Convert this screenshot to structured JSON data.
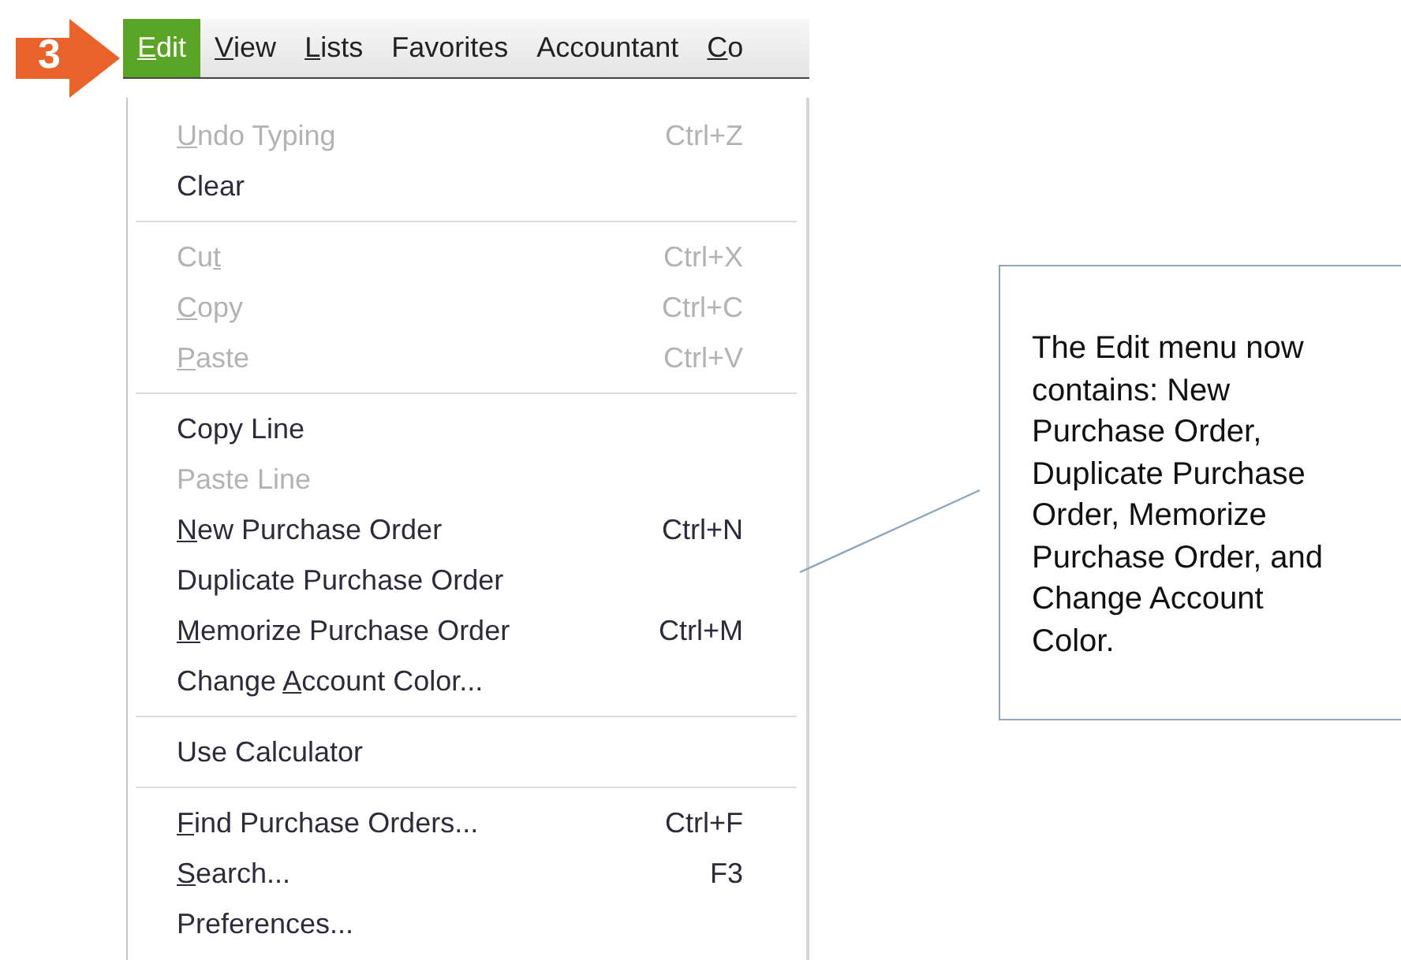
{
  "step_badge": {
    "number": "3"
  },
  "menu_bar": [
    {
      "key": "E",
      "post": "dit",
      "selected": true
    },
    {
      "key": "V",
      "post": "iew",
      "selected": false
    },
    {
      "key": "L",
      "post": "ists",
      "selected": false
    },
    {
      "pre": "Favorites",
      "selected": false
    },
    {
      "pre": "Accountant",
      "selected": false
    },
    {
      "key": "C",
      "post": "o",
      "selected": false
    }
  ],
  "menu": [
    {
      "kind": "item",
      "key": "U",
      "post": "ndo Typing",
      "shortcut": "Ctrl+Z",
      "disabled": true
    },
    {
      "kind": "item",
      "pre": "Clear",
      "disabled": false
    },
    {
      "kind": "separator"
    },
    {
      "kind": "item",
      "pre": "Cu",
      "key": "t",
      "shortcut": "Ctrl+X",
      "disabled": true
    },
    {
      "kind": "item",
      "key": "C",
      "post": "opy",
      "shortcut": "Ctrl+C",
      "disabled": true
    },
    {
      "kind": "item",
      "key": "P",
      "post": "aste",
      "shortcut": "Ctrl+V",
      "disabled": true
    },
    {
      "kind": "separator"
    },
    {
      "kind": "item",
      "pre": "Copy Line",
      "disabled": false
    },
    {
      "kind": "item",
      "pre": "Paste Line",
      "disabled": true
    },
    {
      "kind": "item",
      "key": "N",
      "post": "ew Purchase Order",
      "shortcut": "Ctrl+N",
      "disabled": false
    },
    {
      "kind": "item",
      "pre": "Duplicate Purchase Order",
      "disabled": false
    },
    {
      "kind": "item",
      "key": "M",
      "post": "emorize Purchase Order",
      "shortcut": "Ctrl+M",
      "disabled": false
    },
    {
      "kind": "item",
      "pre": "Change ",
      "key": "A",
      "post": "ccount Color...",
      "disabled": false
    },
    {
      "kind": "separator"
    },
    {
      "kind": "item",
      "pre": "Use Calculator",
      "disabled": false
    },
    {
      "kind": "separator"
    },
    {
      "kind": "item",
      "key": "F",
      "post": "ind Purchase Orders...",
      "shortcut": "Ctrl+F",
      "disabled": false
    },
    {
      "kind": "item",
      "key": "S",
      "post": "earch...",
      "shortcut": "F3",
      "disabled": false
    },
    {
      "kind": "item",
      "pre": "Preferences...",
      "disabled": false
    }
  ],
  "callout": {
    "text": "The Edit menu now contains: New Purchase Order, Duplicate Purchase Order, Memorize Purchase Order, and Change Account Color."
  }
}
